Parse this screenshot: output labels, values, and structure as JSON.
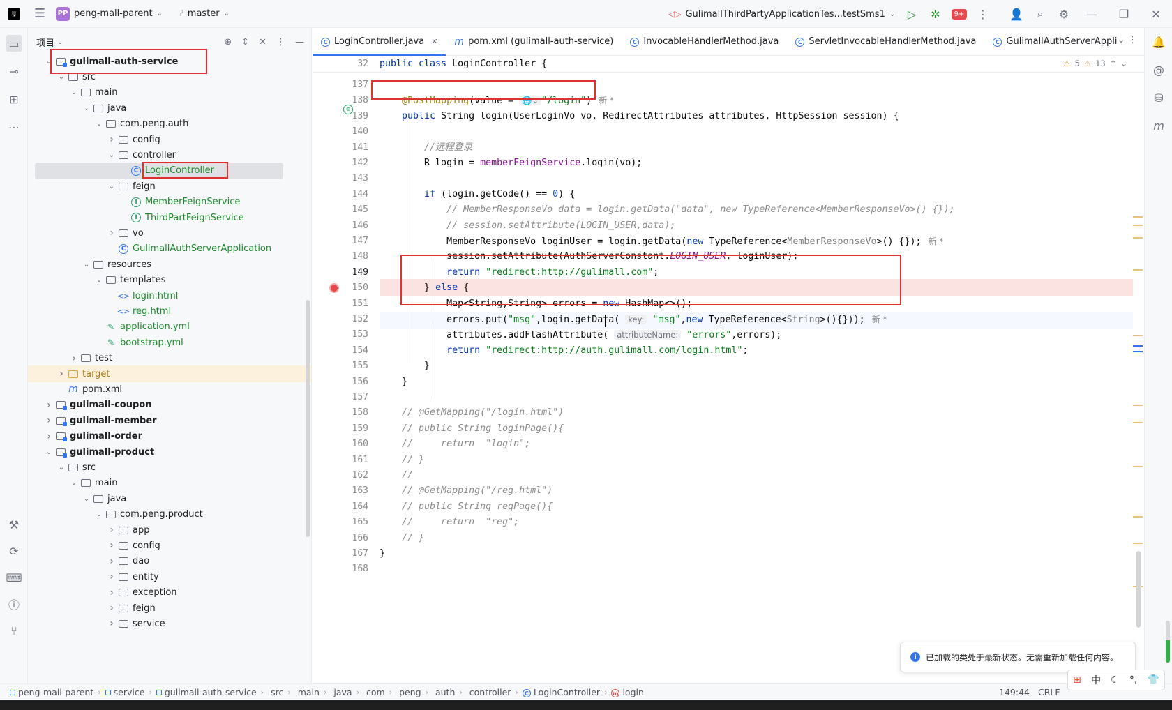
{
  "titlebar": {
    "project_badge": "PP",
    "project": "peng-mall-parent",
    "branch": "master",
    "run_config": "GulimallThirdPartyApplicationTes...testSms1",
    "notif_count": "9+"
  },
  "project_panel": {
    "title": "项目",
    "tree": [
      {
        "label": "gulimall-auth-service",
        "depth": 1,
        "chev": "v",
        "icon": "module",
        "bold": true
      },
      {
        "label": "src",
        "depth": 2,
        "chev": "v",
        "icon": "folder"
      },
      {
        "label": "main",
        "depth": 3,
        "chev": "v",
        "icon": "folder"
      },
      {
        "label": "java",
        "depth": 4,
        "chev": "v",
        "icon": "folder-src"
      },
      {
        "label": "com.peng.auth",
        "depth": 5,
        "chev": "v",
        "icon": "package"
      },
      {
        "label": "config",
        "depth": 6,
        "chev": ">",
        "icon": "package"
      },
      {
        "label": "controller",
        "depth": 6,
        "chev": "v",
        "icon": "package"
      },
      {
        "label": "LoginController",
        "depth": 7,
        "chev": "",
        "icon": "class",
        "selected": true,
        "green": true
      },
      {
        "label": "feign",
        "depth": 6,
        "chev": "v",
        "icon": "package"
      },
      {
        "label": "MemberFeignService",
        "depth": 7,
        "chev": "",
        "icon": "interface",
        "green": true
      },
      {
        "label": "ThirdPartFeignService",
        "depth": 7,
        "chev": "",
        "icon": "interface",
        "green": true
      },
      {
        "label": "vo",
        "depth": 6,
        "chev": ">",
        "icon": "package"
      },
      {
        "label": "GulimallAuthServerApplication",
        "depth": 6,
        "chev": "",
        "icon": "class",
        "green": true
      },
      {
        "label": "resources",
        "depth": 4,
        "chev": "v",
        "icon": "folder"
      },
      {
        "label": "templates",
        "depth": 5,
        "chev": "v",
        "icon": "folder"
      },
      {
        "label": "login.html",
        "depth": 6,
        "chev": "",
        "icon": "html",
        "green": true
      },
      {
        "label": "reg.html",
        "depth": 6,
        "chev": "",
        "icon": "html",
        "green": true
      },
      {
        "label": "application.yml",
        "depth": 5,
        "chev": "",
        "icon": "yml",
        "green": true
      },
      {
        "label": "bootstrap.yml",
        "depth": 5,
        "chev": "",
        "icon": "yml",
        "green": true
      },
      {
        "label": "test",
        "depth": 3,
        "chev": ">",
        "icon": "folder"
      },
      {
        "label": "target",
        "depth": 2,
        "chev": ">",
        "icon": "folder-orange",
        "target": true
      },
      {
        "label": "pom.xml",
        "depth": 2,
        "chev": "",
        "icon": "maven"
      },
      {
        "label": "gulimall-coupon",
        "depth": 1,
        "chev": ">",
        "icon": "module",
        "bold": true
      },
      {
        "label": "gulimall-member",
        "depth": 1,
        "chev": ">",
        "icon": "module",
        "bold": true
      },
      {
        "label": "gulimall-order",
        "depth": 1,
        "chev": ">",
        "icon": "module",
        "bold": true
      },
      {
        "label": "gulimall-product",
        "depth": 1,
        "chev": "v",
        "icon": "module",
        "bold": true
      },
      {
        "label": "src",
        "depth": 2,
        "chev": "v",
        "icon": "folder"
      },
      {
        "label": "main",
        "depth": 3,
        "chev": "v",
        "icon": "folder"
      },
      {
        "label": "java",
        "depth": 4,
        "chev": "v",
        "icon": "folder-src"
      },
      {
        "label": "com.peng.product",
        "depth": 5,
        "chev": "v",
        "icon": "package"
      },
      {
        "label": "app",
        "depth": 6,
        "chev": ">",
        "icon": "package"
      },
      {
        "label": "config",
        "depth": 6,
        "chev": ">",
        "icon": "package"
      },
      {
        "label": "dao",
        "depth": 6,
        "chev": ">",
        "icon": "package"
      },
      {
        "label": "entity",
        "depth": 6,
        "chev": ">",
        "icon": "package"
      },
      {
        "label": "exception",
        "depth": 6,
        "chev": ">",
        "icon": "package"
      },
      {
        "label": "feign",
        "depth": 6,
        "chev": ">",
        "icon": "package"
      },
      {
        "label": "service",
        "depth": 6,
        "chev": ">",
        "icon": "package"
      }
    ]
  },
  "tabs": [
    {
      "label": "LoginController.java",
      "icon": "C",
      "active": true,
      "closable": true
    },
    {
      "label": "pom.xml (gulimall-auth-service)",
      "icon": "m"
    },
    {
      "label": "InvocableHandlerMethod.java",
      "icon": "C"
    },
    {
      "label": "ServletInvocableHandlerMethod.java",
      "icon": "C"
    },
    {
      "label": "GulimallAuthServerApplicat",
      "icon": "C"
    }
  ],
  "editor": {
    "sticky_line_no": "32",
    "sticky_line": "public class LoginController {",
    "warnings": "5",
    "weak_warnings": "13",
    "lines": [
      {
        "n": "137",
        "tokens": []
      },
      {
        "n": "138",
        "tokens": [
          [
            "ann",
            "    @PostMapping"
          ],
          [
            "",
            "(value = "
          ],
          [
            "hint",
            "🌐⌄"
          ],
          [
            "str",
            "\"/login\""
          ],
          [
            "",
            ")"
          ],
          [
            "new",
            "新 *"
          ]
        ]
      },
      {
        "n": "139",
        "tokens": [
          [
            "kw",
            "    public "
          ],
          [
            "",
            "String "
          ],
          [
            "",
            "login(UserLoginVo vo, RedirectAttributes attributes, HttpSession session) {"
          ]
        ]
      },
      {
        "n": "140",
        "tokens": []
      },
      {
        "n": "141",
        "tokens": [
          [
            "cmt",
            "        //远程登录"
          ]
        ]
      },
      {
        "n": "142",
        "tokens": [
          [
            "",
            "        R login = "
          ],
          [
            "fld",
            "memberFeignService"
          ],
          [
            "",
            ".login(vo);"
          ]
        ]
      },
      {
        "n": "143",
        "tokens": []
      },
      {
        "n": "144",
        "tokens": [
          [
            "kw",
            "        if "
          ],
          [
            "",
            "(login.getCode() == "
          ],
          [
            "num",
            "0"
          ],
          [
            "",
            ") {"
          ]
        ]
      },
      {
        "n": "145",
        "tokens": [
          [
            "cmt",
            "            // MemberResponseVo data = login.getData(\"data\", new TypeReference<MemberResponseVo>() {});"
          ]
        ]
      },
      {
        "n": "146",
        "tokens": [
          [
            "cmt",
            "            // session.setAttribute(LOGIN_USER,data);"
          ]
        ]
      },
      {
        "n": "147",
        "tokens": [
          [
            "",
            "            MemberResponseVo loginUser = login.getData("
          ],
          [
            "kw",
            "new "
          ],
          [
            "",
            "TypeReference<"
          ],
          [
            "gen",
            "MemberResponseVo"
          ],
          [
            "",
            ">() {});"
          ],
          [
            "new",
            "新 *"
          ]
        ]
      },
      {
        "n": "148",
        "tokens": [
          [
            "",
            "            session.setAttribute(AuthServerConstant."
          ],
          [
            "sfld",
            "LOGIN_USER"
          ],
          [
            "",
            ", loginUser);"
          ]
        ]
      },
      {
        "n": "149",
        "tokens": [
          [
            "kw",
            "            return "
          ],
          [
            "str",
            "\"redirect:http://gulimall.com\""
          ],
          [
            "",
            ";"
          ]
        ]
      },
      {
        "n": "150",
        "tokens": [
          [
            "",
            "        } "
          ],
          [
            "kw",
            "else "
          ],
          [
            "",
            "{"
          ]
        ]
      },
      {
        "n": "151",
        "tokens": [
          [
            "",
            "            Map<String,String> errors = "
          ],
          [
            "kw",
            "new "
          ],
          [
            "",
            "HashMap<>();"
          ]
        ]
      },
      {
        "n": "152",
        "tokens": [
          [
            "",
            "            errors.put("
          ],
          [
            "str",
            "\"msg\""
          ],
          [
            "",
            ",login.getData( "
          ],
          [
            "hint",
            "key:"
          ],
          [
            "str",
            " \"msg\""
          ],
          [
            "",
            ","
          ],
          [
            "kw",
            "new "
          ],
          [
            "",
            "TypeReference<"
          ],
          [
            "gen",
            "String"
          ],
          [
            "",
            ">(){}));"
          ],
          [
            "new",
            "新 *"
          ]
        ]
      },
      {
        "n": "153",
        "tokens": [
          [
            "",
            "            attributes.addFlashAttribute( "
          ],
          [
            "hint",
            "attributeName:"
          ],
          [
            "str",
            " \"errors\""
          ],
          [
            "",
            ",errors);"
          ]
        ]
      },
      {
        "n": "154",
        "tokens": [
          [
            "kw",
            "            return "
          ],
          [
            "str",
            "\"redirect:http://auth.gulimall.com/login.html\""
          ],
          [
            "",
            ";"
          ]
        ]
      },
      {
        "n": "155",
        "tokens": [
          [
            "",
            "        }"
          ]
        ]
      },
      {
        "n": "156",
        "tokens": [
          [
            "",
            "    }"
          ]
        ]
      },
      {
        "n": "157",
        "tokens": []
      },
      {
        "n": "158",
        "tokens": [
          [
            "cmt",
            "    // @GetMapping(\"/login.html\")"
          ]
        ]
      },
      {
        "n": "159",
        "tokens": [
          [
            "cmt",
            "    // public String loginPage(){"
          ]
        ]
      },
      {
        "n": "160",
        "tokens": [
          [
            "cmt",
            "    //     return  \"login\";"
          ]
        ]
      },
      {
        "n": "161",
        "tokens": [
          [
            "cmt",
            "    // }"
          ]
        ]
      },
      {
        "n": "162",
        "tokens": [
          [
            "cmt",
            "    //"
          ]
        ]
      },
      {
        "n": "163",
        "tokens": [
          [
            "cmt",
            "    // @GetMapping(\"/reg.html\")"
          ]
        ]
      },
      {
        "n": "164",
        "tokens": [
          [
            "cmt",
            "    // public String regPage(){"
          ]
        ]
      },
      {
        "n": "165",
        "tokens": [
          [
            "cmt",
            "    //     return  \"reg\";"
          ]
        ]
      },
      {
        "n": "166",
        "tokens": [
          [
            "cmt",
            "    // }"
          ]
        ]
      },
      {
        "n": "167",
        "tokens": [
          [
            "",
            "}"
          ]
        ]
      },
      {
        "n": "168",
        "tokens": []
      }
    ]
  },
  "notification": {
    "text": "已加载的类处于最新状态。无需重新加载任何内容。",
    "icon": "info-icon"
  },
  "statusbar": {
    "crumbs": [
      "peng-mall-parent",
      "service",
      "gulimall-auth-service",
      "src",
      "main",
      "java",
      "com",
      "peng",
      "auth",
      "controller",
      "LoginController",
      "login"
    ],
    "position": "149:44",
    "line_sep": "CRLF"
  },
  "ime": {
    "lang": "中"
  }
}
